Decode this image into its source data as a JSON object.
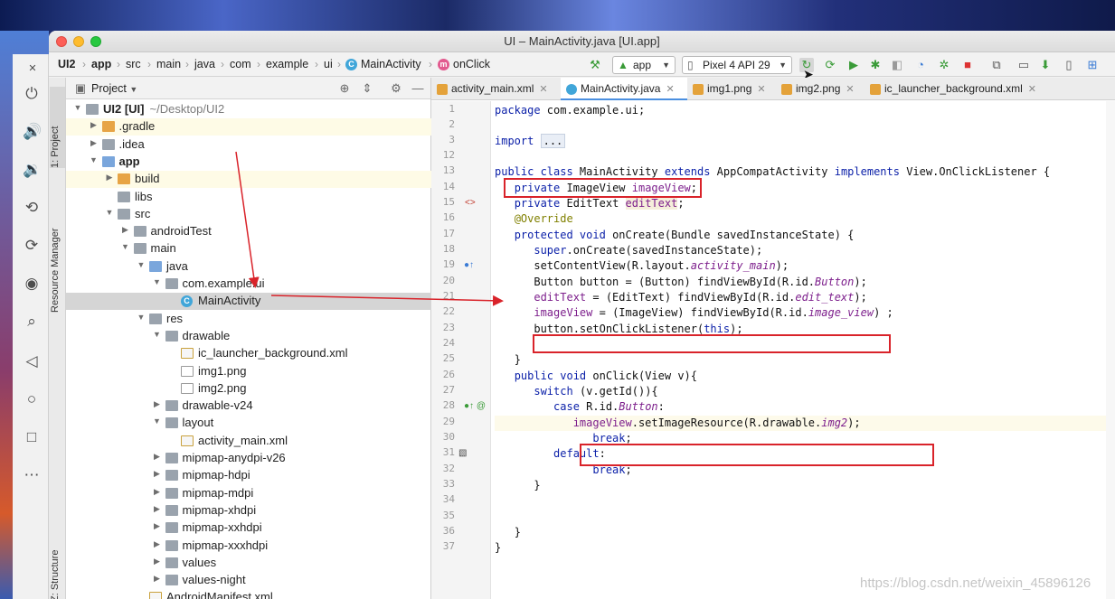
{
  "window": {
    "title": "UI – MainActivity.java [UI.app]"
  },
  "breadcrumbs": [
    "UI2",
    "app",
    "src",
    "main",
    "java",
    "com",
    "example",
    "ui",
    "MainActivity",
    "onClick"
  ],
  "toolbar": {
    "run_config": "app",
    "device": "Pixel 4 API 29"
  },
  "tool_stripe": {
    "project_tab": "1: Project",
    "resource_manager_tab": "Resource Manager",
    "structure_tab": "Z: Structure"
  },
  "project_panel": {
    "title": "Project",
    "tree": [
      {
        "label": "UI2 [UI]",
        "path": "~/Desktop/UI2"
      },
      {
        "label": ".gradle"
      },
      {
        "label": ".idea"
      },
      {
        "label": "app"
      },
      {
        "label": "build"
      },
      {
        "label": "libs"
      },
      {
        "label": "src"
      },
      {
        "label": "androidTest"
      },
      {
        "label": "main"
      },
      {
        "label": "java"
      },
      {
        "label": "com.example.ui"
      },
      {
        "label": "MainActivity"
      },
      {
        "label": "res"
      },
      {
        "label": "drawable"
      },
      {
        "label": "ic_launcher_background.xml"
      },
      {
        "label": "img1.png"
      },
      {
        "label": "img2.png"
      },
      {
        "label": "drawable-v24"
      },
      {
        "label": "layout"
      },
      {
        "label": "activity_main.xml"
      },
      {
        "label": "mipmap-anydpi-v26"
      },
      {
        "label": "mipmap-hdpi"
      },
      {
        "label": "mipmap-mdpi"
      },
      {
        "label": "mipmap-xhdpi"
      },
      {
        "label": "mipmap-xxhdpi"
      },
      {
        "label": "mipmap-xxxhdpi"
      },
      {
        "label": "values"
      },
      {
        "label": "values-night"
      },
      {
        "label": "AndroidManifest.xml"
      }
    ]
  },
  "editor": {
    "tabs": [
      "activity_main.xml",
      "MainActivity.java",
      "img1.png",
      "img2.png",
      "ic_launcher_background.xml"
    ],
    "active_tab": "MainActivity.java",
    "line_numbers": [
      "1",
      "2",
      "3",
      "12",
      "13",
      "14",
      "15",
      "16",
      "17",
      "18",
      "19",
      "20",
      "21",
      "22",
      "23",
      "24",
      "25",
      "26",
      "27",
      "28",
      "29",
      "30",
      "31",
      "32",
      "33",
      "34",
      "35",
      "36",
      "37"
    ],
    "code": {
      "l1_kw": "package",
      "l1_rest": " com.example.ui;",
      "l3_kw": "import",
      "l3_fold": "...",
      "l13_kw": "public class",
      "l13_a": " MainActivity ",
      "l13_kw2": "extends",
      "l13_b": " AppCompatActivity ",
      "l13_kw3": "implements",
      "l13_c": " View.OnClickListener {",
      "l14_kw": "private",
      "l14_a": " ImageView ",
      "l14_f": "imageView",
      "l14_b": ";",
      "l15_kw": "private",
      "l15_a": " EditText ",
      "l15_f": "editText",
      "l15_b": ";",
      "l16_an": "@Override",
      "l17_kw": "protected void",
      "l17_a": " onCreate(Bundle savedInstanceState) {",
      "l18_kw": "super",
      "l18_a": ".onCreate(savedInstanceState);",
      "l19_a": "setContentView(R.layout.",
      "l19_f": "activity_main",
      "l19_b": ");",
      "l20_a": "Button button = (Button) findViewById(R.id.",
      "l20_f": "Button",
      "l20_b": ");",
      "l21_f": "editText",
      "l21_a": " = (EditText) findViewById(R.id.",
      "l21_f2": "edit_text",
      "l21_b": ");",
      "l22_f": "imageView",
      "l22_a": " = (ImageView) findViewById(R.id.",
      "l22_f2": "image_view",
      "l22_b": ") ;",
      "l23_a": "button.setOnClickListener(",
      "l23_kw": "this",
      "l23_b": ");",
      "l25": "}",
      "l26_kw": "public void",
      "l26_a": " onClick(View v){",
      "l27_kw": "switch",
      "l27_a": " (v.getId()){",
      "l28_kw": "case",
      "l28_a": " R.id.",
      "l28_f": "Button",
      "l28_b": ":",
      "l29_f": "imageView",
      "l29_a": ".setImageResource(R.drawable.",
      "l29_f2": "img2",
      "l29_b": ");",
      "l30_kw": "break",
      "l30_b": ";",
      "l31_kw": "default",
      "l31_b": ":",
      "l32_kw": "break",
      "l32_b": ";",
      "l33": "}",
      "l36": "}",
      "l37": "}"
    }
  },
  "watermark": "https://blog.csdn.net/weixin_45896126",
  "colors": {
    "keyword": "#0a1fa8",
    "field": "#7d1f8c",
    "annotation": "#808000",
    "redbox": "#d9232a"
  }
}
